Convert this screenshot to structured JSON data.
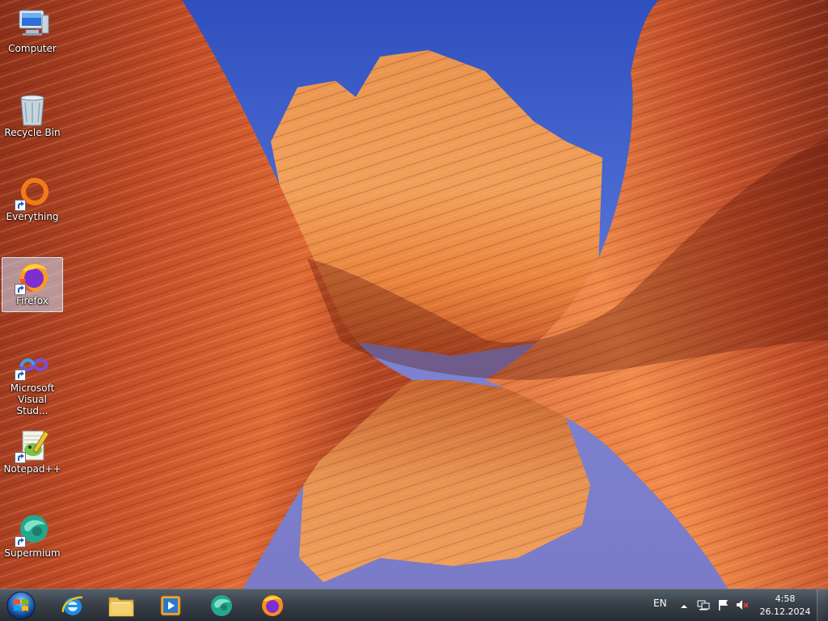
{
  "desktop": {
    "icons": [
      {
        "label": "Computer",
        "icon": "computer-icon",
        "selected": false,
        "shortcut": false
      },
      {
        "label": "Recycle Bin",
        "icon": "recycle-bin-icon",
        "selected": false,
        "shortcut": false
      },
      {
        "label": "Everything",
        "icon": "everything-icon",
        "selected": false,
        "shortcut": true
      },
      {
        "label": "Firefox",
        "icon": "firefox-icon",
        "selected": true,
        "shortcut": true
      },
      {
        "label": "Microsoft Visual Stud...",
        "icon": "visual-studio-icon",
        "selected": false,
        "shortcut": true
      },
      {
        "label": "Notepad++",
        "icon": "notepad-plus-plus-icon",
        "selected": false,
        "shortcut": true
      },
      {
        "label": "Supermium",
        "icon": "supermium-icon",
        "selected": false,
        "shortcut": true
      }
    ]
  },
  "taskbar": {
    "start": {
      "icon": "windows-orb-icon"
    },
    "pinned": [
      {
        "name": "Internet Explorer",
        "icon": "internet-explorer-icon"
      },
      {
        "name": "File Explorer",
        "icon": "folder-icon"
      },
      {
        "name": "Media Player",
        "icon": "media-player-icon"
      },
      {
        "name": "Supermium",
        "icon": "supermium-icon"
      },
      {
        "name": "Firefox",
        "icon": "firefox-icon"
      }
    ],
    "tray": {
      "language": "EN",
      "icons": [
        "show-hidden-icons-chevron",
        "network-icon",
        "action-center-flag-icon",
        "volume-muted-icon"
      ],
      "time": "4:58",
      "date": "26.12.2024"
    }
  },
  "colors": {
    "sky": "#2f4fbf",
    "rock_orange": "#e8743a",
    "rock_dark": "#9a3a1e",
    "selection": "#c8dcf5"
  }
}
